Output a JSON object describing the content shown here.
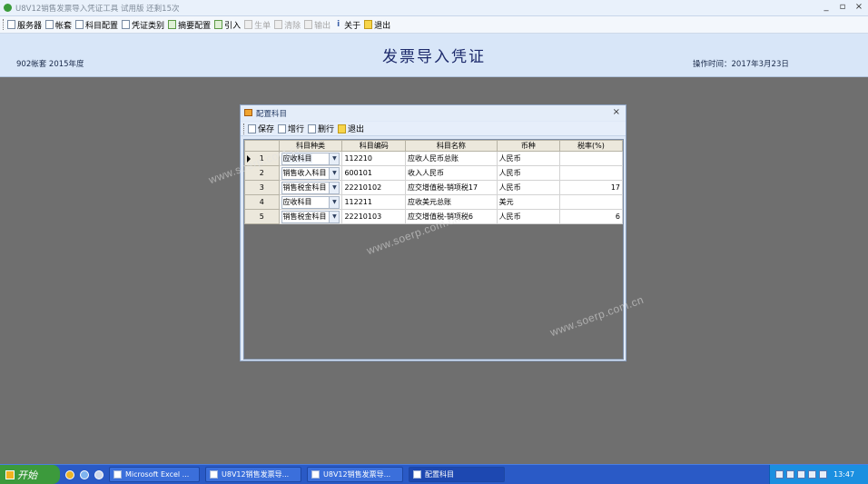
{
  "app": {
    "title": "U8V12销售发票导入凭证工具  试用版  还剩15次",
    "window_controls": {
      "minimize": "_",
      "restore": "▫",
      "close": "×"
    }
  },
  "toolbar": {
    "items": [
      {
        "label": "服务器",
        "icon": "server-icon",
        "enabled": true
      },
      {
        "label": "帐套",
        "icon": "account-icon",
        "enabled": true
      },
      {
        "label": "科目配置",
        "icon": "subject-config-icon",
        "enabled": true
      },
      {
        "label": "凭证类别",
        "icon": "voucher-type-icon",
        "enabled": true
      },
      {
        "label": "摘要配置",
        "icon": "summary-config-icon",
        "enabled": true
      },
      {
        "label": "引入",
        "icon": "import-icon",
        "enabled": true
      },
      {
        "label": "生单",
        "icon": "generate-icon",
        "enabled": false
      },
      {
        "label": "清除",
        "icon": "clear-icon",
        "enabled": false
      },
      {
        "label": "输出",
        "icon": "export-icon",
        "enabled": false
      },
      {
        "label": "关于",
        "icon": "info-icon",
        "enabled": true
      },
      {
        "label": "退出",
        "icon": "exit-icon",
        "enabled": true
      }
    ]
  },
  "header": {
    "account": "902帐套  2015年度",
    "title": "发票导入凭证",
    "op_time": "操作时间：2017年3月23日"
  },
  "dialog": {
    "title": "配置科目",
    "close": "×",
    "toolbar": {
      "save": "保存",
      "add": "增行",
      "delete": "删行",
      "exit": "退出"
    },
    "columns": [
      "科目种类",
      "科目编码",
      "科目名称",
      "币种",
      "税率(%)"
    ],
    "rows": [
      {
        "no": "1",
        "type": "应收科目",
        "code": "112210",
        "name": "应收人民币总账",
        "currency": "人民币",
        "rate": ""
      },
      {
        "no": "2",
        "type": "销售收入科目",
        "code": "600101",
        "name": "收入人民币",
        "currency": "人民币",
        "rate": ""
      },
      {
        "no": "3",
        "type": "销售税金科目",
        "code": "22210102",
        "name": "应交增值税-销项税17",
        "currency": "人民币",
        "rate": "17"
      },
      {
        "no": "4",
        "type": "应收科目",
        "code": "112211",
        "name": "应收美元总账",
        "currency": "美元",
        "rate": ""
      },
      {
        "no": "5",
        "type": "销售税金科目",
        "code": "22210103",
        "name": "应交增值税-销项税6",
        "currency": "人民币",
        "rate": "6"
      }
    ]
  },
  "watermark": "www.soerp.com.cn",
  "taskbar": {
    "start": "开始",
    "tasks": [
      "Microsoft Excel ...",
      "U8V12销售发票导...",
      "U8V12销售发票导...",
      "配置科目"
    ],
    "clock": "13:47"
  }
}
